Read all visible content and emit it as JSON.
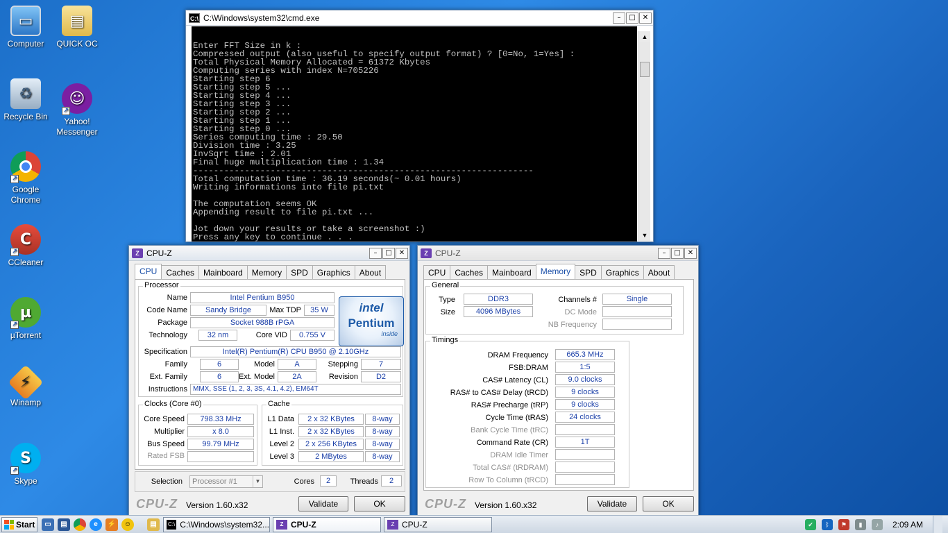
{
  "desktop": {
    "icons": [
      {
        "label": "Computer"
      },
      {
        "label": "QUICK OC"
      },
      {
        "label": "Recycle Bin"
      },
      {
        "label": "Yahoo! Messenger"
      },
      {
        "label": "Google Chrome"
      },
      {
        "label": "CCleaner"
      },
      {
        "label": "µTorrent"
      },
      {
        "label": "Winamp"
      },
      {
        "label": "Skype"
      }
    ]
  },
  "cmd": {
    "title": "C:\\Windows\\system32\\cmd.exe",
    "output": "Enter FFT Size in k :\nCompressed output (also useful to specify output format) ? [0=No, 1=Yes] :\nTotal Physical Memory Allocated = 61372 Kbytes\nComputing series with index N=705226\nStarting step 6\nStarting step 5 ...\nStarting step 4 ...\nStarting step 3 ...\nStarting step 2 ...\nStarting step 1 ...\nStarting step 0 ...\nSeries computing time : 29.50\nDivision time : 3.25\nInvSqrt time : 2.01\nFinal huge multiplication time : 1.34\n------------------------------------------------------------------\nTotal computation time : 36.19 seconds(~ 0.01 hours)\nWriting informations into file pi.txt\n\nThe computation seems OK\nAppending result to file pi.txt ...\n\nJot down your results or take a screenshot :)\nPress any key to continue . . ."
  },
  "cpuz_common": {
    "title": "CPU-Z",
    "tabs": [
      "CPU",
      "Caches",
      "Mainboard",
      "Memory",
      "SPD",
      "Graphics",
      "About"
    ],
    "brand": "CPU-Z",
    "version": "Version 1.60.x32",
    "validate": "Validate",
    "ok": "OK"
  },
  "cpu": {
    "processor_label": "Processor",
    "name_label": "Name",
    "name": "Intel Pentium B950",
    "codename_label": "Code Name",
    "codename": "Sandy Bridge",
    "maxtdp_label": "Max TDP",
    "maxtdp": "35 W",
    "package_label": "Package",
    "package": "Socket 988B rPGA",
    "technology_label": "Technology",
    "technology": "32 nm",
    "corevid_label": "Core VID",
    "corevid": "0.755 V",
    "spec_label": "Specification",
    "spec": "Intel(R) Pentium(R) CPU B950 @ 2.10GHz",
    "family_label": "Family",
    "family": "6",
    "model_label": "Model",
    "model": "A",
    "stepping_label": "Stepping",
    "stepping": "7",
    "extfamily_label": "Ext. Family",
    "extfamily": "6",
    "extmodel_label": "Ext. Model",
    "extmodel": "2A",
    "revision_label": "Revision",
    "revision": "D2",
    "instructions_label": "Instructions",
    "instructions": "MMX, SSE (1, 2, 3, 3S, 4.1, 4.2), EM64T",
    "logo": {
      "brand": "intel",
      "product": "Pentium",
      "tag": "inside"
    },
    "clocks_label": "Clocks (Core #0)",
    "corespeed_label": "Core Speed",
    "corespeed": "798.33 MHz",
    "multiplier_label": "Multiplier",
    "multiplier": "x 8.0",
    "busspeed_label": "Bus Speed",
    "busspeed": "99.79 MHz",
    "ratedfsb_label": "Rated FSB",
    "ratedfsb": "",
    "cache_label": "Cache",
    "l1data_label": "L1 Data",
    "l1data": "2 x 32 KBytes",
    "l1data_way": "8-way",
    "l1inst_label": "L1 Inst.",
    "l1inst": "2 x 32 KBytes",
    "l1inst_way": "8-way",
    "level2_label": "Level 2",
    "level2": "2 x 256 KBytes",
    "level2_way": "8-way",
    "level3_label": "Level 3",
    "level3": "2 MBytes",
    "level3_way": "8-way",
    "selection_label": "Selection",
    "selection": "Processor #1",
    "cores_label": "Cores",
    "cores": "2",
    "threads_label": "Threads",
    "threads": "2"
  },
  "memory": {
    "general_label": "General",
    "type_label": "Type",
    "type": "DDR3",
    "size_label": "Size",
    "size": "4096 MBytes",
    "channels_label": "Channels #",
    "channels": "Single",
    "dcmode_label": "DC Mode",
    "dcmode": "",
    "nbfreq_label": "NB Frequency",
    "nbfreq": "",
    "timings_label": "Timings",
    "dramfreq_label": "DRAM Frequency",
    "dramfreq": "665.3 MHz",
    "fsbdram_label": "FSB:DRAM",
    "fsbdram": "1:5",
    "cl_label": "CAS# Latency (CL)",
    "cl": "9.0 clocks",
    "trcd_label": "RAS# to CAS# Delay (tRCD)",
    "trcd": "9 clocks",
    "trp_label": "RAS# Precharge (tRP)",
    "trp": "9 clocks",
    "tras_label": "Cycle Time (tRAS)",
    "tras": "24 clocks",
    "trc_label": "Bank Cycle Time (tRC)",
    "trc": "",
    "cr_label": "Command Rate (CR)",
    "cr": "1T",
    "idle_label": "DRAM Idle Timer",
    "idle": "",
    "trdram_label": "Total CAS# (tRDRAM)",
    "trdram": "",
    "trcd2_label": "Row To Column (tRCD)",
    "trcd2": ""
  },
  "taskbar": {
    "start": "Start",
    "tasks": [
      {
        "label": "C:\\Windows\\system32..."
      },
      {
        "label": "CPU-Z"
      },
      {
        "label": "CPU-Z"
      }
    ],
    "clock": "2:09 AM"
  }
}
